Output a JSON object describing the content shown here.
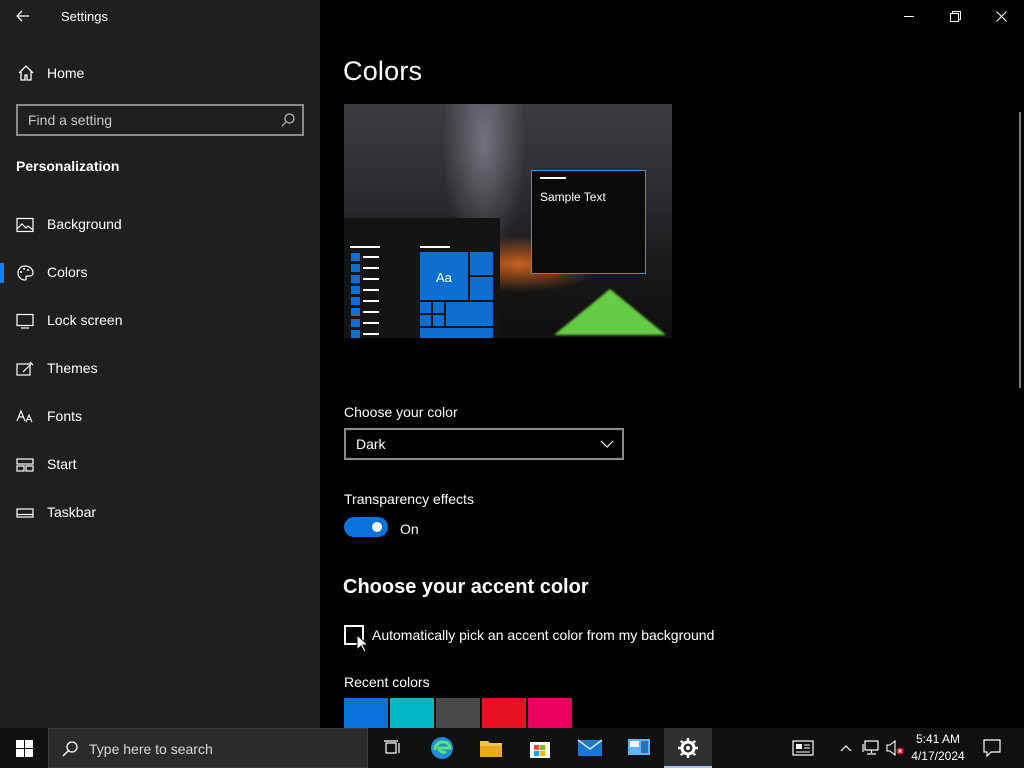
{
  "window": {
    "title": "Settings"
  },
  "sidebar": {
    "home_label": "Home",
    "search_placeholder": "Find a setting",
    "section_title": "Personalization",
    "items": [
      {
        "label": "Background",
        "icon": "picture-icon"
      },
      {
        "label": "Colors",
        "icon": "palette-icon",
        "active": true
      },
      {
        "label": "Lock screen",
        "icon": "lock-screen-icon"
      },
      {
        "label": "Themes",
        "icon": "themes-icon"
      },
      {
        "label": "Fonts",
        "icon": "fonts-icon"
      },
      {
        "label": "Start",
        "icon": "start-icon"
      },
      {
        "label": "Taskbar",
        "icon": "taskbar-icon"
      }
    ]
  },
  "main": {
    "page_title": "Colors",
    "preview": {
      "sample_text": "Sample Text",
      "tile_text": "Aa"
    },
    "choose_color": {
      "label": "Choose your color",
      "value": "Dark"
    },
    "transparency": {
      "label": "Transparency effects",
      "state_label": "On",
      "on": true
    },
    "accent": {
      "heading": "Choose your accent color",
      "auto_label": "Automatically pick an accent color from my background",
      "auto_checked": false,
      "recent_label": "Recent colors",
      "recent_colors": [
        "#0a73d9",
        "#00b7c3",
        "#4a4a4a",
        "#e81123",
        "#ea005e"
      ]
    }
  },
  "taskbar": {
    "search_text": "Type here to search",
    "time": "5:41 AM",
    "date": "4/17/2024"
  },
  "colors": {
    "accent": "#0a73d9",
    "sidebar_bg": "#1f1f1f",
    "main_bg": "#000000"
  }
}
